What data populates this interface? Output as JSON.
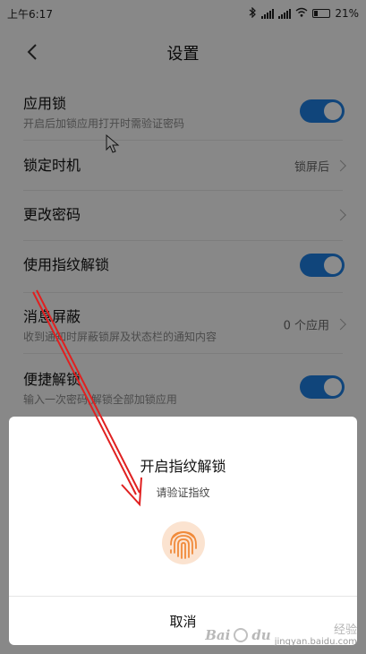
{
  "status_bar": {
    "time": "上午6:17",
    "battery": "21%"
  },
  "header": {
    "title": "设置"
  },
  "settings": {
    "app_lock": {
      "label": "应用锁",
      "desc": "开启后加锁应用打开时需验证密码",
      "enabled": true
    },
    "lock_timing": {
      "label": "锁定时机",
      "value": "锁屏后"
    },
    "change_password": {
      "label": "更改密码"
    },
    "fingerprint_unlock": {
      "label": "使用指纹解锁",
      "enabled": true
    },
    "message_mask": {
      "label": "消息屏蔽",
      "desc": "收到通知时屏蔽锁屏及状态栏的通知内容",
      "value": "0 个应用"
    },
    "quick_unlock": {
      "label": "便捷解锁",
      "desc": "输入一次密码,解锁全部加锁应用",
      "enabled": true
    }
  },
  "dialog": {
    "title": "开启指纹解锁",
    "subtitle": "请验证指纹",
    "cancel": "取消"
  },
  "watermark": {
    "brand": "Bai",
    "brand2": "du",
    "label": "经验",
    "url": "jingyan.baidu.com"
  },
  "colors": {
    "accent": "#1e7fe0",
    "fingerprint": "#f08a3a",
    "annotation_arrow": "#e02020"
  }
}
